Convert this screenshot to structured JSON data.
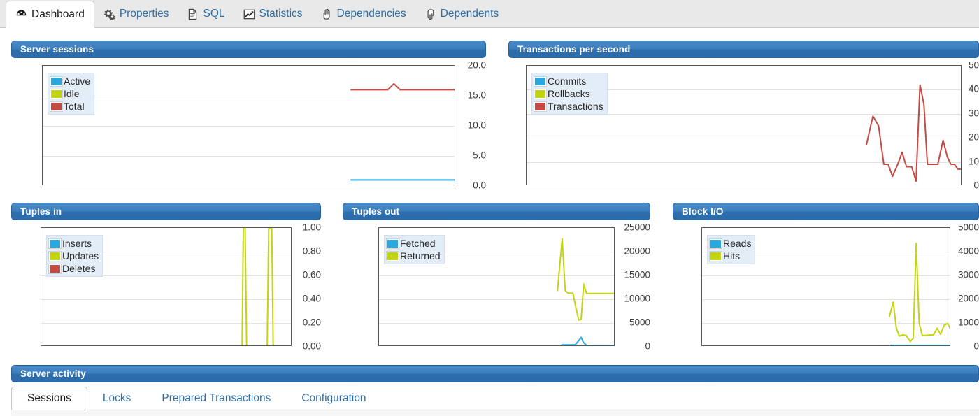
{
  "tabs": [
    {
      "label": "Dashboard",
      "icon": "dashboard-gauge-icon",
      "active": true
    },
    {
      "label": "Properties",
      "icon": "gears-icon",
      "active": false
    },
    {
      "label": "SQL",
      "icon": "document-icon",
      "active": false
    },
    {
      "label": "Statistics",
      "icon": "chart-line-icon",
      "active": false
    },
    {
      "label": "Dependencies",
      "icon": "hand-up-icon",
      "active": false
    },
    {
      "label": "Dependents",
      "icon": "hand-down-icon",
      "active": false
    }
  ],
  "colors": {
    "blue": "#29a8dd",
    "green": "#c3d512",
    "red": "#c64a44",
    "header_blue": "#2f6fae",
    "link_blue": "#2f6ea5"
  },
  "panels": {
    "server_sessions": {
      "title": "Server sessions"
    },
    "transactions": {
      "title": "Transactions per second"
    },
    "tuples_in": {
      "title": "Tuples in"
    },
    "tuples_out": {
      "title": "Tuples out"
    },
    "block_io": {
      "title": "Block I/O"
    },
    "server_activity": {
      "title": "Server activity"
    }
  },
  "activity_tabs": [
    {
      "label": "Sessions",
      "active": true
    },
    {
      "label": "Locks",
      "active": false
    },
    {
      "label": "Prepared Transactions",
      "active": false
    },
    {
      "label": "Configuration",
      "active": false
    }
  ],
  "chart_data": [
    {
      "id": "server_sessions",
      "type": "line",
      "title": "Server sessions",
      "xlabel": "",
      "ylabel": "",
      "ylim": [
        0,
        20
      ],
      "yticks": [
        "0.0",
        "5.0",
        "10.0",
        "15.0",
        "20.0"
      ],
      "ytick_values": [
        0,
        5,
        10,
        15,
        20
      ],
      "grid": true,
      "legend": "top-left",
      "series": [
        {
          "name": "Active",
          "color": "#29a8dd",
          "x": [
            0,
            0.745,
            0.76,
            0.78,
            0.8,
            0.82,
            0.84,
            0.86,
            0.88,
            0.9,
            0.92,
            0.94,
            0.96,
            0.98,
            1.0
          ],
          "values": [
            null,
            1,
            1,
            1,
            1,
            1,
            1,
            1,
            1,
            1,
            1,
            1,
            1,
            1,
            1
          ]
        },
        {
          "name": "Idle",
          "color": "#c3d512",
          "x": [
            0,
            0.745,
            0.76,
            0.78,
            0.8,
            0.82,
            0.84,
            0.86,
            0.88,
            0.9,
            0.92,
            0.94,
            0.96,
            0.98,
            1.0
          ],
          "values": [
            null,
            0,
            0,
            0,
            0,
            0,
            0,
            0,
            0,
            0,
            0,
            0,
            0,
            0,
            0
          ]
        },
        {
          "name": "Total",
          "color": "#c64a44",
          "x": [
            0,
            0.745,
            0.78,
            0.81,
            0.835,
            0.85,
            0.865,
            0.88,
            0.91,
            0.95,
            1.0
          ],
          "values": [
            null,
            16,
            16,
            16,
            16,
            17,
            16,
            16,
            16,
            16,
            16
          ]
        }
      ]
    },
    {
      "id": "transactions",
      "type": "line",
      "title": "Transactions per second",
      "xlabel": "",
      "ylabel": "",
      "ylim": [
        0,
        50
      ],
      "yticks": [
        "0",
        "10",
        "20",
        "30",
        "40",
        "50"
      ],
      "ytick_values": [
        0,
        10,
        20,
        30,
        40,
        50
      ],
      "grid": true,
      "legend": "top-left",
      "series": [
        {
          "name": "Commits",
          "color": "#29a8dd",
          "x": [
            0,
            0.78,
            1.0
          ],
          "values": [
            null,
            0,
            0
          ]
        },
        {
          "name": "Rollbacks",
          "color": "#c3d512",
          "x": [
            0,
            0.78,
            1.0
          ],
          "values": [
            null,
            0,
            0
          ]
        },
        {
          "name": "Transactions",
          "color": "#c64a44",
          "x": [
            0,
            0.78,
            0.795,
            0.808,
            0.82,
            0.83,
            0.84,
            0.852,
            0.862,
            0.872,
            0.884,
            0.894,
            0.903,
            0.912,
            0.92,
            0.928,
            0.936,
            0.944,
            0.956,
            0.966,
            0.974,
            0.982,
            0.99,
            1.0
          ],
          "values": [
            null,
            17,
            29,
            25,
            9,
            9,
            4,
            9,
            14,
            8,
            8,
            2,
            42,
            34,
            9,
            9,
            9,
            9,
            19,
            12,
            9,
            9,
            7,
            7
          ]
        }
      ]
    },
    {
      "id": "tuples_in",
      "type": "line",
      "title": "Tuples in",
      "xlabel": "",
      "ylabel": "",
      "ylim": [
        0,
        1
      ],
      "yticks": [
        "0.00",
        "0.20",
        "0.40",
        "0.60",
        "0.80",
        "1.00"
      ],
      "ytick_values": [
        0,
        0.2,
        0.4,
        0.6,
        0.8,
        1.0
      ],
      "grid": true,
      "legend": "top-left",
      "series": [
        {
          "name": "Inserts",
          "color": "#29a8dd",
          "x": [
            0,
            0.8,
            1.0
          ],
          "values": [
            null,
            0,
            0
          ]
        },
        {
          "name": "Updates",
          "color": "#c3d512",
          "x": [
            0,
            0.8,
            0.805,
            0.812,
            0.818,
            0.824,
            0.9,
            0.906,
            0.912,
            0.918,
            0.924,
            1.0
          ],
          "values": [
            null,
            0,
            1,
            1,
            0,
            0,
            0,
            1,
            1,
            1,
            0,
            0
          ]
        },
        {
          "name": "Deletes",
          "color": "#c64a44",
          "x": [
            0,
            0.8,
            1.0
          ],
          "values": [
            null,
            0,
            0
          ]
        }
      ]
    },
    {
      "id": "tuples_out",
      "type": "line",
      "title": "Tuples out",
      "xlabel": "",
      "ylabel": "",
      "ylim": [
        0,
        25000
      ],
      "yticks": [
        "0",
        "5000",
        "10000",
        "15000",
        "20000",
        "25000"
      ],
      "ytick_values": [
        0,
        5000,
        10000,
        15000,
        20000,
        25000
      ],
      "grid": true,
      "legend": "top-left",
      "series": [
        {
          "name": "Fetched",
          "color": "#29a8dd",
          "x": [
            0,
            0.76,
            0.775,
            0.79,
            0.83,
            0.845,
            0.855,
            0.865,
            0.88,
            1.0
          ],
          "values": [
            null,
            0,
            400,
            400,
            400,
            1300,
            2000,
            900,
            200,
            200
          ]
        },
        {
          "name": "Returned",
          "color": "#c3d512",
          "x": [
            0,
            0.755,
            0.775,
            0.788,
            0.8,
            0.82,
            0.834,
            0.845,
            0.855,
            0.866,
            0.878,
            0.89,
            0.905,
            1.0
          ],
          "values": [
            null,
            11700,
            22700,
            11800,
            11300,
            11300,
            8000,
            5600,
            5800,
            13200,
            11200,
            11200,
            11200,
            11200
          ]
        }
      ]
    },
    {
      "id": "block_io",
      "type": "line",
      "title": "Block I/O",
      "xlabel": "",
      "ylabel": "",
      "ylim": [
        0,
        5000
      ],
      "yticks": [
        "0",
        "1000",
        "2000",
        "3000",
        "4000",
        "5000"
      ],
      "ytick_values": [
        0,
        1000,
        2000,
        3000,
        4000,
        5000
      ],
      "grid": true,
      "legend": "top-left",
      "series": [
        {
          "name": "Reads",
          "color": "#29a8dd",
          "x": [
            0,
            0.755,
            1.0
          ],
          "values": [
            null,
            60,
            60
          ]
        },
        {
          "name": "Hits",
          "color": "#c3d512",
          "x": [
            0,
            0.752,
            0.768,
            0.78,
            0.792,
            0.806,
            0.82,
            0.836,
            0.848,
            0.86,
            0.872,
            0.884,
            0.9,
            0.916,
            0.93,
            0.944,
            0.958,
            0.972,
            0.986,
            1.0
          ],
          "values": [
            null,
            1250,
            1880,
            800,
            450,
            500,
            480,
            220,
            350,
            4350,
            1000,
            480,
            480,
            500,
            500,
            780,
            520,
            900,
            980,
            700
          ]
        }
      ]
    }
  ]
}
